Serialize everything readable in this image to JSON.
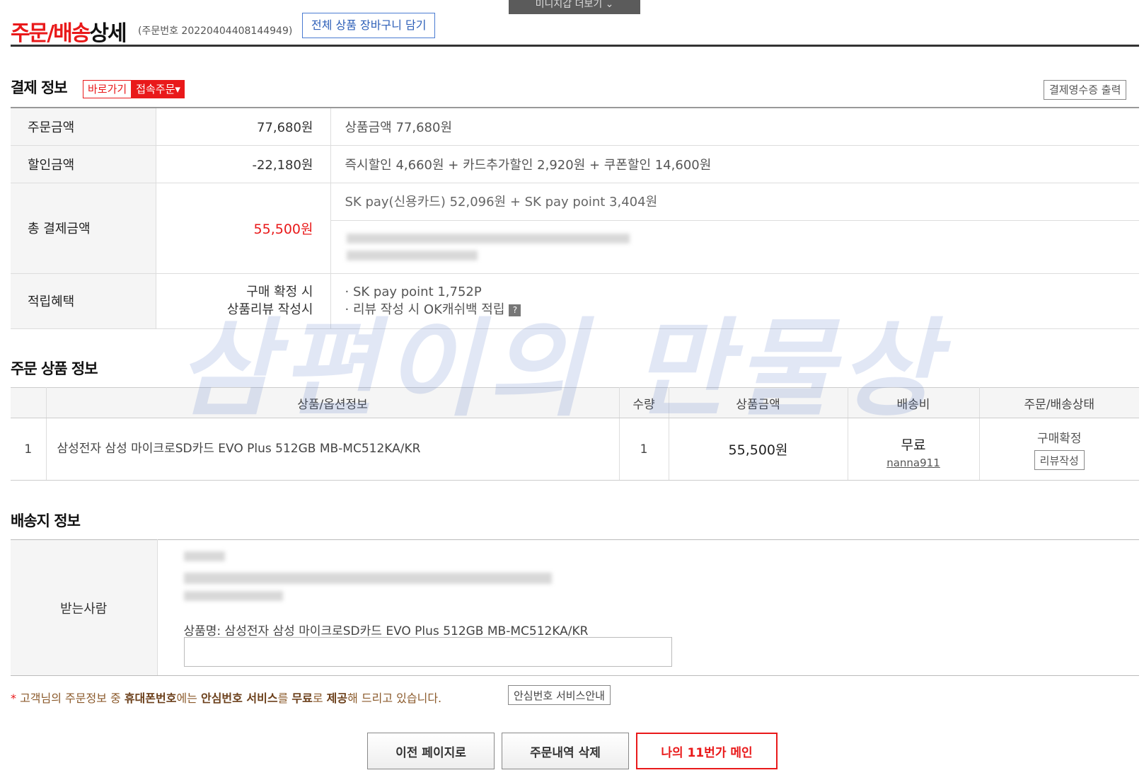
{
  "mini_tab": {
    "label": "미니지갑 더보기 ⌄"
  },
  "header": {
    "title_red": "주문/배송",
    "title_dark": "상세",
    "order_no": "(주문번호 20220404408144949)",
    "cart_button": "전체 상품 장바구니 담기"
  },
  "payment": {
    "section_title": "결제 정보",
    "shortcut_label": "바로가기",
    "shortcut_menu": "접속주문▾",
    "receipt_button": "결제영수증 출력",
    "rows": {
      "order_amount": {
        "label": "주문금액",
        "amount": "77,680원",
        "desc": "상품금액 77,680원"
      },
      "discount": {
        "label": "할인금액",
        "amount": "-22,180원",
        "desc": "즉시할인 4,660원 + 카드추가할인 2,920원 + 쿠폰할인 14,600원"
      },
      "total": {
        "label": "총 결제금액",
        "amount": "55,500원",
        "desc": "SK pay(신용카드) 52,096원 + SK pay point 3,404원"
      },
      "benefit": {
        "label": "적립혜택",
        "left1": "구매 확정 시",
        "left2": "상품리뷰 작성시",
        "right1": "· SK pay point 1,752P",
        "right2": "· 리뷰 작성 시 OK캐쉬백 적립",
        "help": "?"
      }
    }
  },
  "products": {
    "section_title": "주문 상품 정보",
    "headers": [
      "",
      "상품/옵션정보",
      "수량",
      "상품금액",
      "배송비",
      "주문/배송상태"
    ],
    "row": {
      "index": "1",
      "name": "삼성전자 삼성 마이크로SD카드 EVO Plus 512GB MB-MC512KA/KR",
      "qty": "1",
      "price": "55,500원",
      "shipping_fee": "무료",
      "seller": "nanna911",
      "status": "구매확정",
      "review_button": "리뷰작성"
    }
  },
  "shipping": {
    "section_title": "배송지 정보",
    "recipient_label": "받는사람",
    "product_name_line": "상품명: 삼성전자 삼성 마이크로SD카드 EVO Plus 512GB MB-MC512KA/KR"
  },
  "notice": {
    "star": "*",
    "part1": " 고객님의 주문정보 중 ",
    "bold1": "휴대폰번호",
    "part2": "에는 ",
    "bold2": "안심번호 서비스",
    "part3": "를 ",
    "bold3": "무료",
    "part4": "로 ",
    "bold4": "제공",
    "part5": "해 드리고 있습니다.",
    "button": "안심번호 서비스안내"
  },
  "buttons": {
    "prev": "이전 페이지로",
    "delete": "주문내역 삭제",
    "main": "나의 11번가 메인"
  },
  "watermark": "삼편이의 만물상"
}
